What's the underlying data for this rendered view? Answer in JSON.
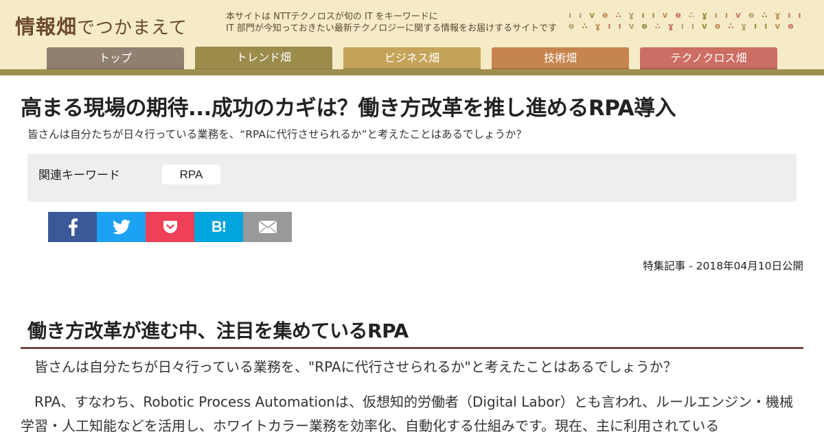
{
  "header": {
    "logo_main": "情報畑",
    "logo_sub": "でつかまえて",
    "tagline_line1": "本サイトは NTTテクノロスが旬の IT をキーワードに",
    "tagline_line2": "IT 部門が今知っておきたい最新テクノロジーに関する情報をお届けするサイトです"
  },
  "nav": {
    "tabs": [
      {
        "label": "トップ"
      },
      {
        "label": "トレンド畑"
      },
      {
        "label": "ビジネス畑"
      },
      {
        "label": "技術畑"
      },
      {
        "label": "テクノクロス畑"
      }
    ]
  },
  "article": {
    "title": "高まる現場の期待...成功のカギは？働き方改革を推し進めるRPA導入",
    "lead": "皆さんは自分たちが日々行っている業務を、“RPAに代行させられるか”と考えたことはあるでしょうか？",
    "keywords_label": "関連キーワード",
    "keywords": [
      "RPA"
    ],
    "date": "特集記事 - 2018年04月10日公開",
    "section_heading": "働き方改革が進む中、注目を集めているRPA",
    "paragraph1": "　皆さんは自分たちが日々行っている業務を、\"RPAに代行させられるか\"と考えたことはあるでしょうか？",
    "paragraph2": "　RPA、すなわち、Robotic Process Automationは、仮想知的労働者（Digital Labor）とも言われ、ルールエンジン・機械学習・人工知能などを活用し、ホワイトカラー業務を効率化、自動化する仕組みです。現在、主に利用されている"
  },
  "share": {
    "buttons": [
      {
        "icon": "facebook-icon",
        "color": "#3b5998"
      },
      {
        "icon": "twitter-icon",
        "color": "#1da1f2"
      },
      {
        "icon": "pocket-icon",
        "color": "#ee4056"
      },
      {
        "icon": "hatena-bookmark-icon",
        "color": "#00a4de",
        "text": "B!"
      },
      {
        "icon": "mail-icon",
        "color": "#999999"
      }
    ]
  },
  "colors": {
    "header_bg": "#f5ebc7",
    "header_bar": "#9e8f4e",
    "tab_top": "#918070",
    "tab_trend": "#9c8c4c",
    "tab_business": "#c5a45a",
    "tab_tech": "#c7854e",
    "tab_technocross": "#cc6e63",
    "heading_rule": "#6b4a40"
  }
}
